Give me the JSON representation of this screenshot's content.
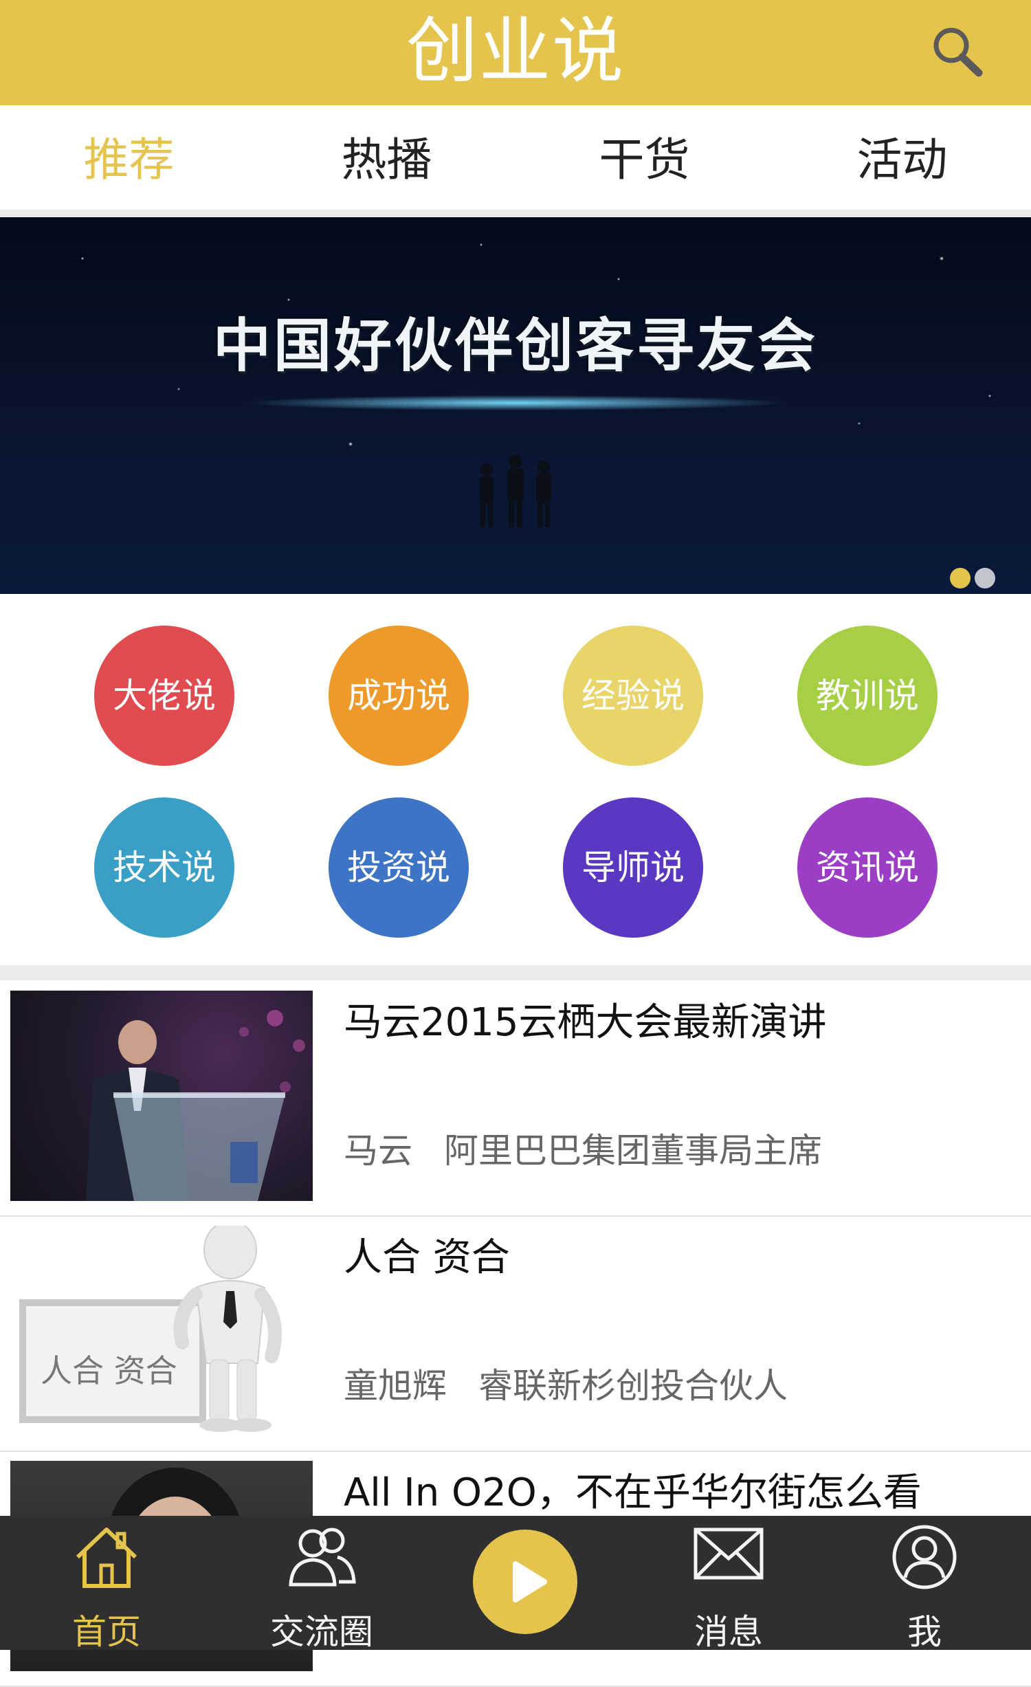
{
  "header": {
    "title": "创业说",
    "color": "#e4c44c"
  },
  "tabs": [
    {
      "label": "推荐",
      "active": true
    },
    {
      "label": "热播",
      "active": false
    },
    {
      "label": "干货",
      "active": false
    },
    {
      "label": "活动",
      "active": false
    }
  ],
  "banner": {
    "title": "中国好伙伴创客寻友会",
    "slide_count": 2,
    "active_slide": 1
  },
  "categories": [
    {
      "label": "大佬说",
      "color": "#e04b4f"
    },
    {
      "label": "成功说",
      "color": "#ee9a2a"
    },
    {
      "label": "经验说",
      "color": "#e8d468"
    },
    {
      "label": "教训说",
      "color": "#a6cf45"
    },
    {
      "label": "技术说",
      "color": "#3a9fc6"
    },
    {
      "label": "投资说",
      "color": "#3d74c5"
    },
    {
      "label": "导师说",
      "color": "#5a38c2"
    },
    {
      "label": "资讯说",
      "color": "#9c3dc6"
    }
  ],
  "articles": [
    {
      "title": "马云2015云栖大会最新演讲",
      "speaker": "马云",
      "position": "阿里巴巴集团董事局主席",
      "thumb_icon": "speaker-podium-photo"
    },
    {
      "title": "人合 资合",
      "speaker": "童旭辉",
      "position": "睿联新杉创投合伙人",
      "thumb_icon": "figure-with-board-illustration",
      "thumb_board_text": "人合 资合"
    },
    {
      "title": "All In O2O，不在乎华尔街怎么看",
      "speaker": "",
      "position": "",
      "thumb_icon": "portrait-photo"
    }
  ],
  "bottom_nav": {
    "items": [
      {
        "label": "首页",
        "icon": "home-icon",
        "active": true
      },
      {
        "label": "交流圈",
        "icon": "people-icon",
        "active": false
      },
      {
        "label": "消息",
        "icon": "mail-icon",
        "active": false
      },
      {
        "label": "我",
        "icon": "user-icon",
        "active": false
      }
    ],
    "center_icon": "play-icon"
  }
}
